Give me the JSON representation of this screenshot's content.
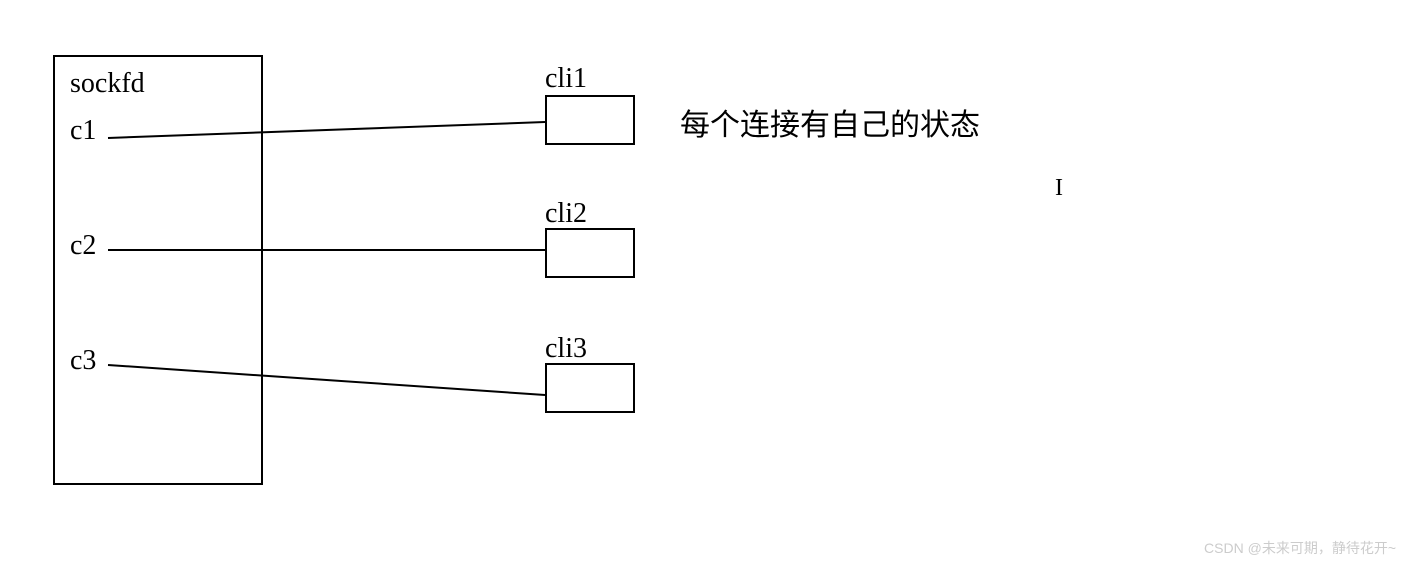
{
  "sockfd": {
    "title": "sockfd",
    "items": [
      {
        "label": "c1"
      },
      {
        "label": "c2"
      },
      {
        "label": "c3"
      }
    ]
  },
  "clients": [
    {
      "label": "cli1"
    },
    {
      "label": "cli2"
    },
    {
      "label": "cli3"
    }
  ],
  "description": "每个连接有自己的状态",
  "cursor": "I",
  "watermark": "CSDN @未来可期，静待花开~"
}
